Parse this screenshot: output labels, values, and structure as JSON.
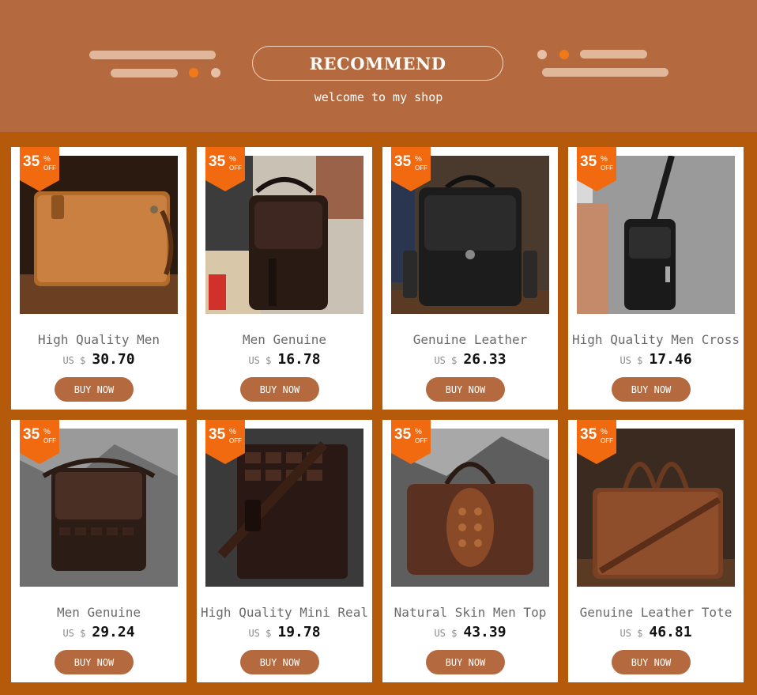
{
  "header": {
    "title": "RECOMMEND",
    "subtitle": "welcome to my shop"
  },
  "colors": {
    "page_bg": "#b45a0a",
    "header_bg": "#b46a3e",
    "badge": "#f26a10",
    "button": "#b46a3e"
  },
  "badge": {
    "number": "35",
    "percent": "%",
    "off": "OFF"
  },
  "products": [
    {
      "name": "High Quality Men",
      "currency": "US $",
      "price": "30.70",
      "button": "BUY NOW",
      "icon": "tan-clutch-bag-icon"
    },
    {
      "name": "Men Genuine",
      "currency": "US $",
      "price": "16.78",
      "button": "BUY NOW",
      "icon": "dark-brown-shoulder-bag-icon"
    },
    {
      "name": "Genuine Leather",
      "currency": "US $",
      "price": "26.33",
      "button": "BUY NOW",
      "icon": "black-messenger-bag-icon"
    },
    {
      "name": "High Quality Men Cross",
      "currency": "US $",
      "price": "17.46",
      "button": "BUY NOW",
      "icon": "black-waist-bag-icon"
    },
    {
      "name": "Men Genuine",
      "currency": "US $",
      "price": "29.24",
      "button": "BUY NOW",
      "icon": "croc-messenger-bag-icon"
    },
    {
      "name": "High Quality Mini Real",
      "currency": "US $",
      "price": "19.78",
      "button": "BUY NOW",
      "icon": "croc-crossbody-bag-icon"
    },
    {
      "name": "Natural Skin Men Top",
      "currency": "US $",
      "price": "43.39",
      "button": "BUY NOW",
      "icon": "croc-briefcase-icon"
    },
    {
      "name": "Genuine Leather Tote",
      "currency": "US $",
      "price": "46.81",
      "button": "BUY NOW",
      "icon": "brown-tote-bag-icon"
    }
  ]
}
